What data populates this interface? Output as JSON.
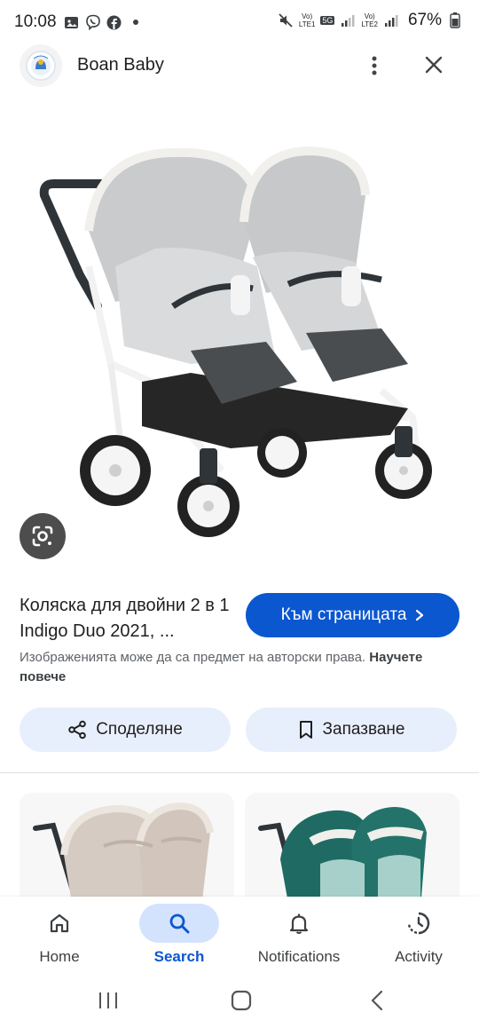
{
  "status_bar": {
    "time": "10:08",
    "battery": "67%",
    "net1_top": "Vo)",
    "net1_bottom": "LTE1",
    "net_badge": "5G",
    "net2_top": "Vo)",
    "net2_bottom": "LTE2"
  },
  "header": {
    "site_name": "Boan Baby"
  },
  "result": {
    "title": "Коляска для двойни 2 в 1 Indigo Duo 2021, ...",
    "visit_label": "Към страницата",
    "copyright_text": "Изображенията може да са предмет на авторски права.",
    "learn_more": "Научете повече"
  },
  "actions": {
    "share_label": "Споделяне",
    "save_label": "Запазване"
  },
  "bottom_nav": {
    "items": [
      {
        "label": "Home",
        "icon": "home-icon"
      },
      {
        "label": "Search",
        "icon": "search-icon",
        "active": true
      },
      {
        "label": "Notifications",
        "icon": "bell-icon"
      },
      {
        "label": "Activity",
        "icon": "activity-icon"
      }
    ]
  },
  "colors": {
    "accent": "#0b57d0",
    "pill_bg": "#e8effc",
    "active_nav_bg": "#d3e3fd"
  }
}
